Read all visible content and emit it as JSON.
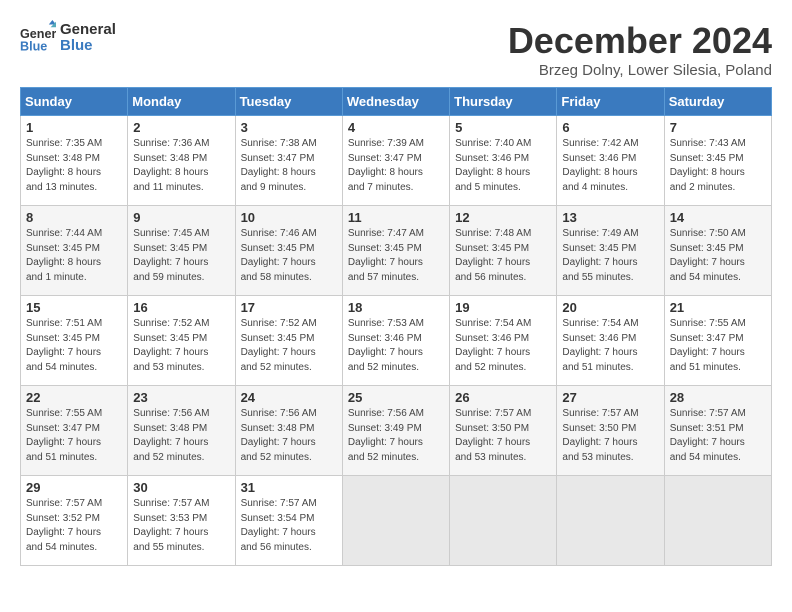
{
  "header": {
    "logo_line1": "General",
    "logo_line2": "Blue",
    "month": "December 2024",
    "location": "Brzeg Dolny, Lower Silesia, Poland"
  },
  "weekdays": [
    "Sunday",
    "Monday",
    "Tuesday",
    "Wednesday",
    "Thursday",
    "Friday",
    "Saturday"
  ],
  "weeks": [
    [
      {
        "day": "1",
        "info": "Sunrise: 7:35 AM\nSunset: 3:48 PM\nDaylight: 8 hours\nand 13 minutes."
      },
      {
        "day": "2",
        "info": "Sunrise: 7:36 AM\nSunset: 3:48 PM\nDaylight: 8 hours\nand 11 minutes."
      },
      {
        "day": "3",
        "info": "Sunrise: 7:38 AM\nSunset: 3:47 PM\nDaylight: 8 hours\nand 9 minutes."
      },
      {
        "day": "4",
        "info": "Sunrise: 7:39 AM\nSunset: 3:47 PM\nDaylight: 8 hours\nand 7 minutes."
      },
      {
        "day": "5",
        "info": "Sunrise: 7:40 AM\nSunset: 3:46 PM\nDaylight: 8 hours\nand 5 minutes."
      },
      {
        "day": "6",
        "info": "Sunrise: 7:42 AM\nSunset: 3:46 PM\nDaylight: 8 hours\nand 4 minutes."
      },
      {
        "day": "7",
        "info": "Sunrise: 7:43 AM\nSunset: 3:45 PM\nDaylight: 8 hours\nand 2 minutes."
      }
    ],
    [
      {
        "day": "8",
        "info": "Sunrise: 7:44 AM\nSunset: 3:45 PM\nDaylight: 8 hours\nand 1 minute."
      },
      {
        "day": "9",
        "info": "Sunrise: 7:45 AM\nSunset: 3:45 PM\nDaylight: 7 hours\nand 59 minutes."
      },
      {
        "day": "10",
        "info": "Sunrise: 7:46 AM\nSunset: 3:45 PM\nDaylight: 7 hours\nand 58 minutes."
      },
      {
        "day": "11",
        "info": "Sunrise: 7:47 AM\nSunset: 3:45 PM\nDaylight: 7 hours\nand 57 minutes."
      },
      {
        "day": "12",
        "info": "Sunrise: 7:48 AM\nSunset: 3:45 PM\nDaylight: 7 hours\nand 56 minutes."
      },
      {
        "day": "13",
        "info": "Sunrise: 7:49 AM\nSunset: 3:45 PM\nDaylight: 7 hours\nand 55 minutes."
      },
      {
        "day": "14",
        "info": "Sunrise: 7:50 AM\nSunset: 3:45 PM\nDaylight: 7 hours\nand 54 minutes."
      }
    ],
    [
      {
        "day": "15",
        "info": "Sunrise: 7:51 AM\nSunset: 3:45 PM\nDaylight: 7 hours\nand 54 minutes."
      },
      {
        "day": "16",
        "info": "Sunrise: 7:52 AM\nSunset: 3:45 PM\nDaylight: 7 hours\nand 53 minutes."
      },
      {
        "day": "17",
        "info": "Sunrise: 7:52 AM\nSunset: 3:45 PM\nDaylight: 7 hours\nand 52 minutes."
      },
      {
        "day": "18",
        "info": "Sunrise: 7:53 AM\nSunset: 3:46 PM\nDaylight: 7 hours\nand 52 minutes."
      },
      {
        "day": "19",
        "info": "Sunrise: 7:54 AM\nSunset: 3:46 PM\nDaylight: 7 hours\nand 52 minutes."
      },
      {
        "day": "20",
        "info": "Sunrise: 7:54 AM\nSunset: 3:46 PM\nDaylight: 7 hours\nand 51 minutes."
      },
      {
        "day": "21",
        "info": "Sunrise: 7:55 AM\nSunset: 3:47 PM\nDaylight: 7 hours\nand 51 minutes."
      }
    ],
    [
      {
        "day": "22",
        "info": "Sunrise: 7:55 AM\nSunset: 3:47 PM\nDaylight: 7 hours\nand 51 minutes."
      },
      {
        "day": "23",
        "info": "Sunrise: 7:56 AM\nSunset: 3:48 PM\nDaylight: 7 hours\nand 52 minutes."
      },
      {
        "day": "24",
        "info": "Sunrise: 7:56 AM\nSunset: 3:48 PM\nDaylight: 7 hours\nand 52 minutes."
      },
      {
        "day": "25",
        "info": "Sunrise: 7:56 AM\nSunset: 3:49 PM\nDaylight: 7 hours\nand 52 minutes."
      },
      {
        "day": "26",
        "info": "Sunrise: 7:57 AM\nSunset: 3:50 PM\nDaylight: 7 hours\nand 53 minutes."
      },
      {
        "day": "27",
        "info": "Sunrise: 7:57 AM\nSunset: 3:50 PM\nDaylight: 7 hours\nand 53 minutes."
      },
      {
        "day": "28",
        "info": "Sunrise: 7:57 AM\nSunset: 3:51 PM\nDaylight: 7 hours\nand 54 minutes."
      }
    ],
    [
      {
        "day": "29",
        "info": "Sunrise: 7:57 AM\nSunset: 3:52 PM\nDaylight: 7 hours\nand 54 minutes."
      },
      {
        "day": "30",
        "info": "Sunrise: 7:57 AM\nSunset: 3:53 PM\nDaylight: 7 hours\nand 55 minutes."
      },
      {
        "day": "31",
        "info": "Sunrise: 7:57 AM\nSunset: 3:54 PM\nDaylight: 7 hours\nand 56 minutes."
      },
      null,
      null,
      null,
      null
    ]
  ]
}
